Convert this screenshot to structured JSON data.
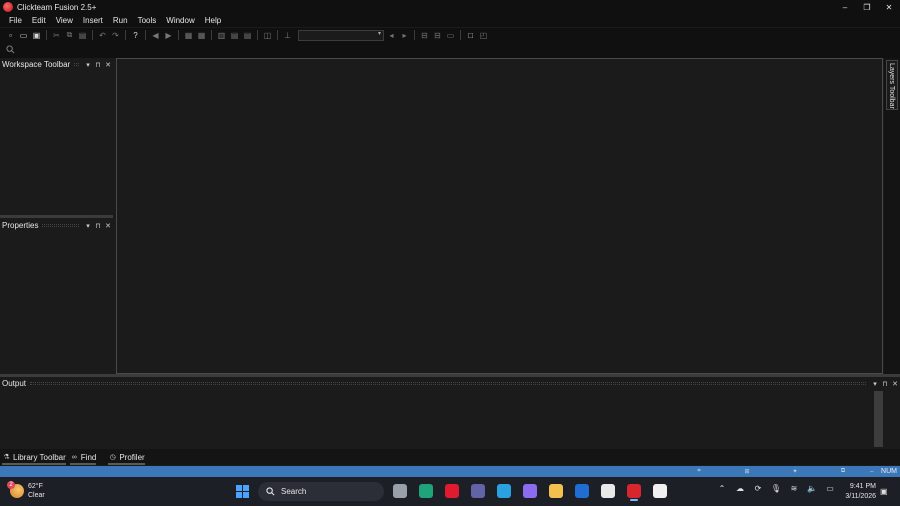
{
  "window": {
    "title": "Clickteam Fusion 2.5+",
    "controls": {
      "minimize": "–",
      "restore": "❐",
      "close": "✕"
    }
  },
  "menu": [
    "File",
    "Edit",
    "View",
    "Insert",
    "Run",
    "Tools",
    "Window",
    "Help"
  ],
  "toolbar": {
    "icons": [
      "new-icon",
      "open-icon",
      "save-icon",
      "cut-icon",
      "copy-icon",
      "paste-icon",
      "undo-icon",
      "redo-icon",
      "help-icon",
      "back-icon",
      "forward-icon",
      "storyboard-editor-icon",
      "frame-editor-icon",
      "event-editor-icon",
      "event-list-icon",
      "data-elements-icon",
      "run-icon",
      "align-icon",
      "arrange-icon",
      "shape-icon",
      "box-icon",
      "layers-icon"
    ],
    "combo_value": ""
  },
  "panels": {
    "workspace": {
      "title": "Workspace Toolbar"
    },
    "properties": {
      "title": "Properties"
    },
    "output": {
      "title": "Output"
    },
    "layers": {
      "title": "Layers Toolbar"
    }
  },
  "panel_buttons": {
    "dropdown": "▾",
    "pin": "⊓",
    "close": "✕"
  },
  "dock_tabs": [
    {
      "label": "Library Toolbar",
      "icon": "library-icon"
    },
    {
      "label": "Find",
      "icon": "binoculars-icon"
    },
    {
      "label": "Profiler",
      "icon": "clock-icon"
    }
  ],
  "statusbar": {
    "num": "NUM"
  },
  "taskbar": {
    "weather": {
      "temp": "62°F",
      "condition": "Clear",
      "badge": "2"
    },
    "search_label": "Search",
    "clock": {
      "time": "9:41 PM",
      "date": "3/11/2026"
    },
    "tray_icons": [
      "chevron-up-icon",
      "cloud-icon",
      "sync-icon",
      "mic-icon",
      "wifi-icon",
      "volume-icon",
      "battery-icon"
    ],
    "pinned": [
      {
        "name": "task-view-icon",
        "color": "#9aa0aa",
        "active": false
      },
      {
        "name": "edge-icon",
        "color": "#1fa37a",
        "active": false
      },
      {
        "name": "opera-icon",
        "color": "#e01b2f",
        "active": false
      },
      {
        "name": "teams-icon",
        "color": "#6264a7",
        "active": false
      },
      {
        "name": "chrome-icon",
        "color": "#2aa1e0",
        "active": false
      },
      {
        "name": "copilot-icon",
        "color": "#8b6cf0",
        "active": false
      },
      {
        "name": "file-explorer-icon",
        "color": "#f2c14e",
        "active": false
      },
      {
        "name": "hp-icon",
        "color": "#1f6ed4",
        "active": false
      },
      {
        "name": "store-icon",
        "color": "#e8e8e8",
        "active": false
      },
      {
        "name": "clickteam-icon",
        "color": "#d8262e",
        "active": true
      },
      {
        "name": "app-editor-icon",
        "color": "#f0f0f0",
        "active": false
      }
    ]
  }
}
